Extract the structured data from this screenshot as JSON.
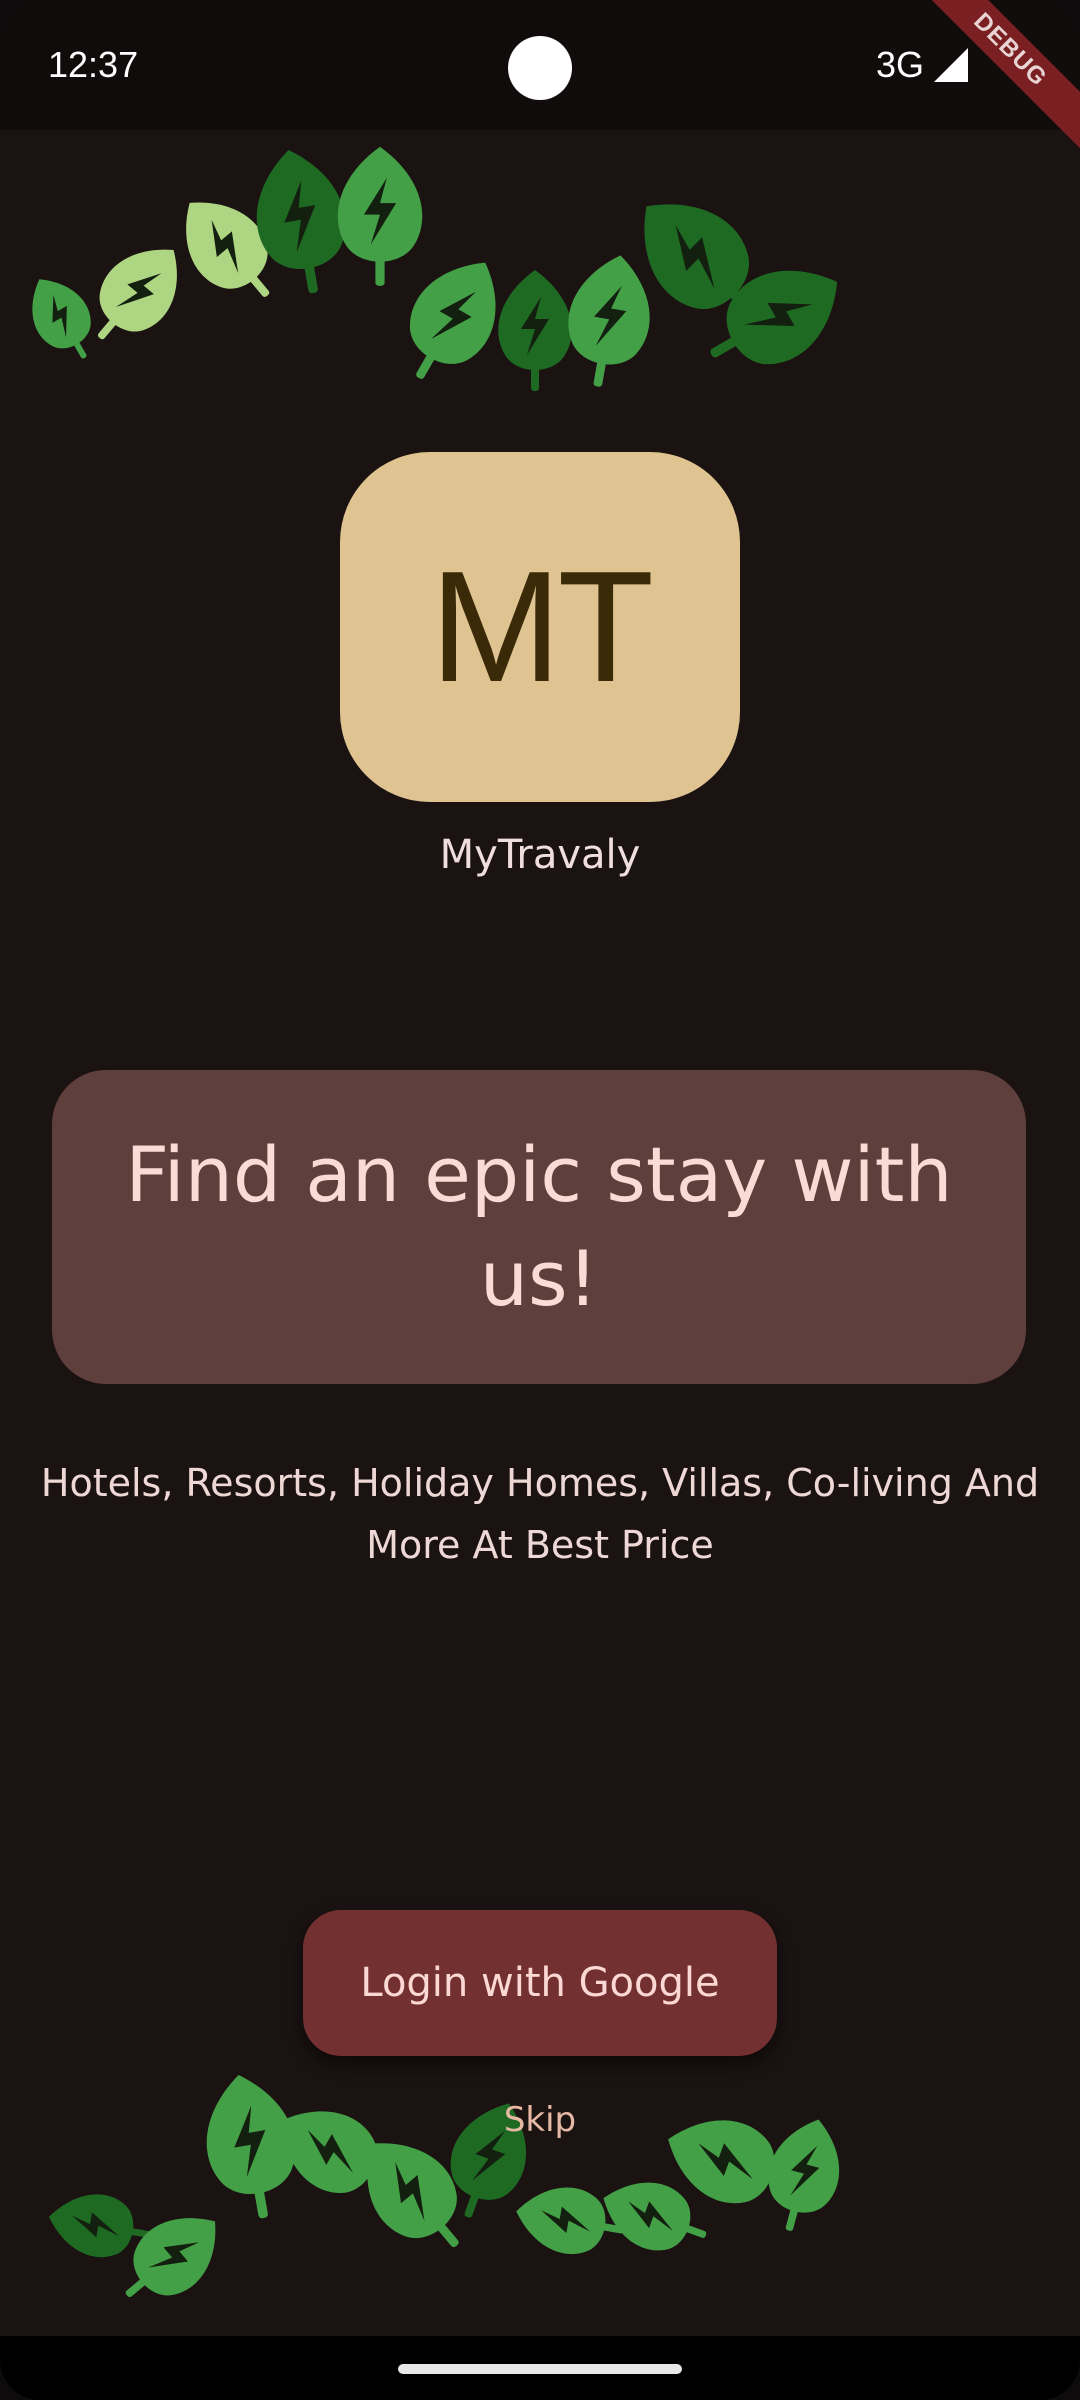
{
  "status_bar": {
    "time": "12:37",
    "network": "3G",
    "debug_label": "DEBUG"
  },
  "logo": {
    "initials": "MT",
    "app_name": "MyTravaly"
  },
  "headline": "Find an epic stay with us!",
  "subtitle": "Hotels, Resorts, Holiday Homes, Villas, Co-living And More At Best Price",
  "actions": {
    "login_label": "Login with Google",
    "skip_label": "Skip"
  },
  "colors": {
    "background": "#1b1212",
    "logo_bg": "#dfc391",
    "card_bg": "#5e3f3c",
    "button_bg": "#733030",
    "leaf_dark": "#1e6a22",
    "leaf_mid": "#43a047",
    "leaf_light": "#aed581"
  },
  "icons": {
    "leaf": "eco-leaf-icon",
    "signal": "cell-signal-icon"
  }
}
